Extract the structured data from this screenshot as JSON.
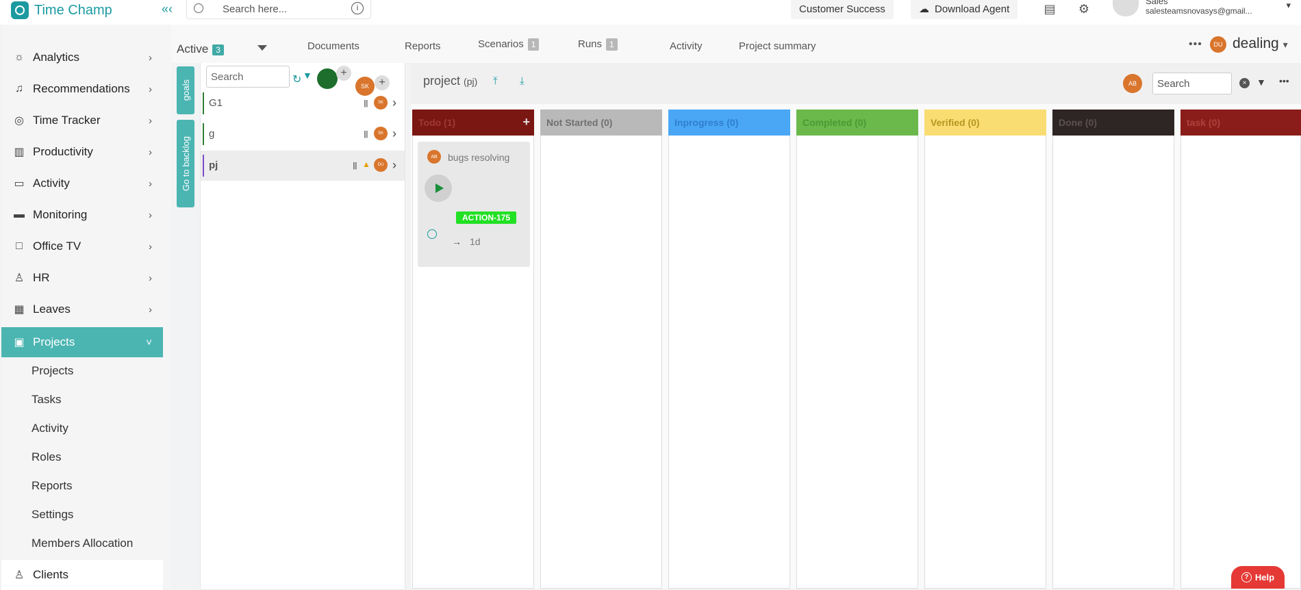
{
  "app": {
    "title": "Time Champ"
  },
  "topbar": {
    "search_placeholder": "Search here...",
    "customer_success": "Customer Success",
    "download_agent": "Download Agent",
    "user_name": "Sales",
    "user_email": "salesteamsnovasys@gmail..."
  },
  "sidebar": {
    "items": [
      {
        "label": "Analytics",
        "icon": "bulb-icon"
      },
      {
        "label": "Recommendations",
        "icon": "bell-icon"
      },
      {
        "label": "Time Tracker",
        "icon": "timer-icon"
      },
      {
        "label": "Productivity",
        "icon": "chart-icon"
      },
      {
        "label": "Activity",
        "icon": "ticket-icon"
      },
      {
        "label": "Monitoring",
        "icon": "monitor-icon"
      },
      {
        "label": "Office TV",
        "icon": "tv-icon"
      },
      {
        "label": "HR",
        "icon": "person-icon"
      },
      {
        "label": "Leaves",
        "icon": "calendar-icon"
      },
      {
        "label": "Projects",
        "icon": "briefcase-icon"
      }
    ],
    "sub_items": [
      "Projects",
      "Tasks",
      "Activity",
      "Roles",
      "Reports",
      "Settings",
      "Members Allocation"
    ],
    "clients": "Clients"
  },
  "tabs": {
    "active_label": "Active",
    "active_count": "3",
    "documents": "Documents",
    "reports": "Reports",
    "scenarios": "Scenarios",
    "scenarios_count": "1",
    "runs": "Runs",
    "runs_count": "1",
    "activity": "Activity",
    "project_summary": "Project summary",
    "project_avatar": "DU",
    "project_name": "dealing"
  },
  "side_tabs": {
    "goals": "goals",
    "backlog": "Go to backlog"
  },
  "goals": {
    "search_placeholder": "Search",
    "owner_avatar": "SK",
    "rows": [
      {
        "name": "G1",
        "avatar": "SK",
        "bar": "#2e7d32"
      },
      {
        "name": "g",
        "avatar": "SK",
        "bar": "#2e7d32"
      },
      {
        "name": "pj",
        "avatar": "DU",
        "bar": "#7b4cc9"
      }
    ]
  },
  "board": {
    "title": "project",
    "code": "(pj)",
    "avatar": "AB",
    "search_placeholder": "Search",
    "columns": [
      {
        "label": "Todo (1)",
        "bg": "#7b1712",
        "fg": "#9e3a33"
      },
      {
        "label": "Not Started (0)",
        "bg": "#b9b9b9",
        "fg": "#707070"
      },
      {
        "label": "Inprogress (0)",
        "bg": "#4aa7f5",
        "fg": "#2f7fcf"
      },
      {
        "label": "Completed (0)",
        "bg": "#6bb84b",
        "fg": "#4a9a35"
      },
      {
        "label": "Verified (0)",
        "bg": "#f9dd72",
        "fg": "#b59520"
      },
      {
        "label": "Done (0)",
        "bg": "#2e2525",
        "fg": "#5e5050"
      },
      {
        "label": "task (0)",
        "bg": "#8a1d1a",
        "fg": "#b0423c"
      }
    ],
    "card": {
      "avatar": "AB",
      "title": "bugs resolving",
      "tag": "ACTION-175",
      "duration": "1d"
    }
  },
  "help": "Help"
}
